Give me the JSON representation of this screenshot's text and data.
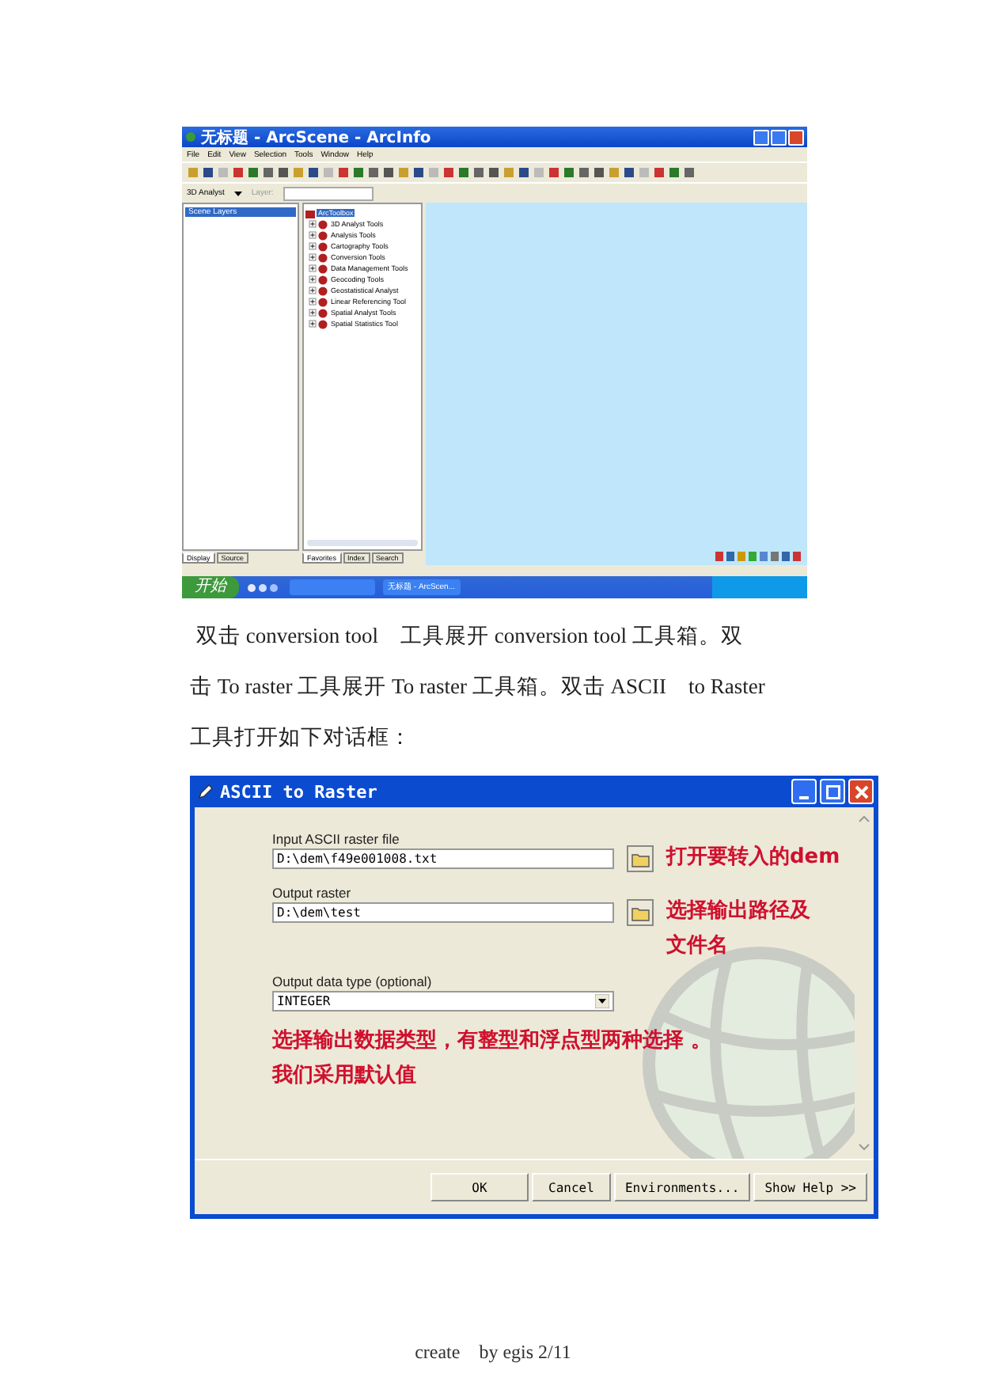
{
  "arcscene_window": {
    "title": "无标题 - ArcScene - ArcInfo",
    "menu": [
      "File",
      "Edit",
      "View",
      "Selection",
      "Tools",
      "Window",
      "Help"
    ],
    "analyst_dropdown": "3D Analyst",
    "layer_label": "Layer:",
    "layers_panel": {
      "items": [
        {
          "label": "Scene Layers",
          "selected": true
        }
      ],
      "tabs": [
        {
          "label": "Display",
          "selected": true
        },
        {
          "label": "Source",
          "selected": false
        }
      ]
    },
    "toolbox": {
      "root": {
        "label": "ArcToolbox",
        "selected": true,
        "children": [
          {
            "label": "3D Analyst Tools",
            "expanded": false
          },
          {
            "label": "Analysis Tools",
            "expanded": false
          },
          {
            "label": "Cartography Tools",
            "expanded": false
          },
          {
            "label": "Conversion Tools",
            "expanded": false
          },
          {
            "label": "Data Management Tools",
            "expanded": false
          },
          {
            "label": "Geocoding Tools",
            "expanded": false
          },
          {
            "label": "Geostatistical Analyst",
            "expanded": false
          },
          {
            "label": "Linear Referencing Tool",
            "expanded": false
          },
          {
            "label": "Spatial Analyst Tools",
            "expanded": false
          },
          {
            "label": "Spatial Statistics Tool",
            "expanded": false
          }
        ]
      },
      "tabs": [
        {
          "label": "Favorites",
          "selected": true
        },
        {
          "label": "Index",
          "selected": false
        },
        {
          "label": "Search",
          "selected": false
        }
      ]
    },
    "taskbar": {
      "start": "开始",
      "tasks": [
        {
          "label": "无标题 - ArcScen...",
          "selected": false
        }
      ]
    }
  },
  "paragraph": {
    "lines": [
      "双击 conversion tool　工具展开 conversion tool 工具箱。双",
      "击 To raster 工具展开 To raster 工具箱。双击 ASCII　to Raster",
      "工具打开如下对话框："
    ]
  },
  "dialog": {
    "title": "ASCII to Raster",
    "fields": [
      {
        "kind": "file",
        "label": "Input ASCII raster file",
        "value": "D:\\dem\\f49e001008.txt",
        "note": [
          "打开要转入的dem"
        ]
      },
      {
        "kind": "file",
        "label": "Output raster",
        "value": "D:\\dem\\test",
        "note": [
          "选择输出路径及",
          "文件名"
        ]
      },
      {
        "kind": "dropdown",
        "label": "Output data type (optional)",
        "value": "INTEGER"
      }
    ],
    "notes": [
      "选择输出数据类型，有整型和浮点型两种选择 。",
      "我们采用默认值"
    ],
    "buttons": [
      "OK",
      "Cancel",
      "Environments...",
      "Show Help >>"
    ]
  },
  "footer": "create　by egis 2/11"
}
